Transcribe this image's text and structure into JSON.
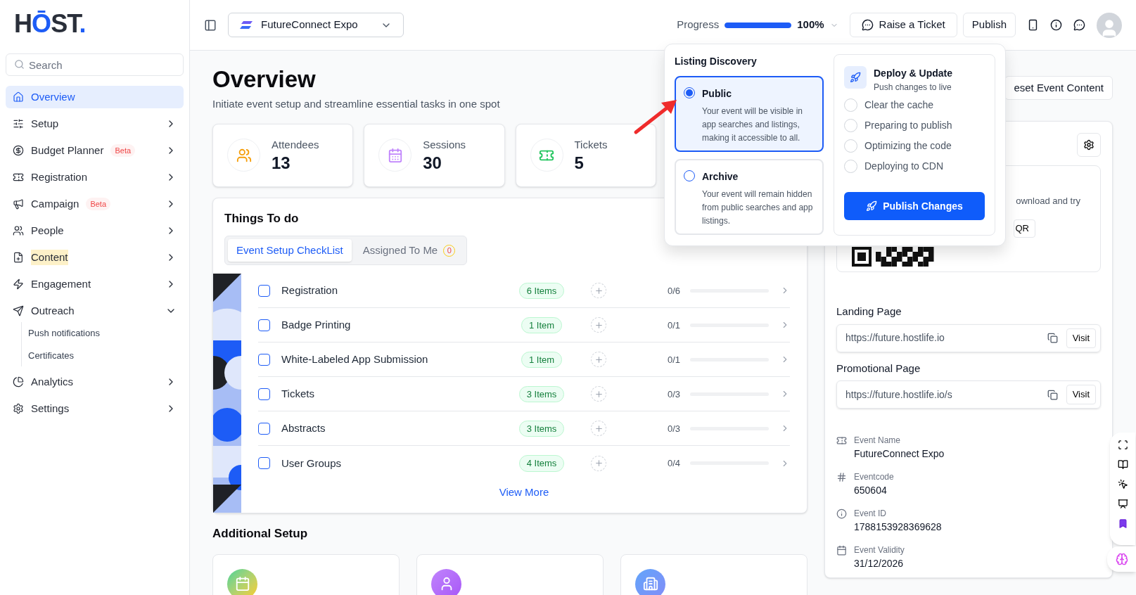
{
  "logo": {
    "parts": [
      {
        "text": "H",
        "accent": false
      },
      {
        "text": "Ō",
        "accent": true
      },
      {
        "text": "ST",
        "accent": false
      },
      {
        "text": ".",
        "accent": true
      }
    ]
  },
  "sidebar": {
    "search_placeholder": "Search",
    "items": [
      {
        "label": "Overview",
        "selected": true
      },
      {
        "label": "Setup",
        "selected": false,
        "expanded": false
      },
      {
        "label": "Budget Planner",
        "badge": "Beta",
        "selected": false,
        "expanded": false
      },
      {
        "label": "Registration",
        "selected": false,
        "expanded": false
      },
      {
        "label": "Campaign",
        "badge": "Beta",
        "selected": false,
        "expanded": false
      },
      {
        "label": "People",
        "selected": false,
        "expanded": false
      },
      {
        "label": "Content",
        "selected": false,
        "highlighted": true,
        "expanded": false
      },
      {
        "label": "Engagement",
        "selected": false,
        "expanded": false
      },
      {
        "label": "Outreach",
        "selected": false,
        "expanded": true,
        "children": [
          {
            "label": "Push notifications"
          },
          {
            "label": "Certificates"
          }
        ]
      },
      {
        "label": "Analytics",
        "selected": false,
        "expanded": false
      },
      {
        "label": "Settings",
        "selected": false,
        "expanded": false
      }
    ]
  },
  "topbar": {
    "event": "FutureConnect Expo",
    "progress": {
      "label": "Progress",
      "level": 1,
      "reading": "100%"
    },
    "buttons": [
      "Raise a Ticket",
      "Publish"
    ]
  },
  "page": {
    "title": "Overview",
    "subtitle": "Initiate event setup and streamline essential tasks in one spot",
    "stats": [
      {
        "label": "Attendees",
        "value": "13"
      },
      {
        "label": "Sessions",
        "value": "30"
      },
      {
        "label": "Tickets",
        "value": "5"
      }
    ],
    "todo": {
      "title": "Things To do",
      "tabs": [
        {
          "label": "Event Setup CheckList",
          "selected": true
        },
        {
          "label": "Assigned To Me",
          "count": "0",
          "selected": false
        }
      ],
      "rows": [
        {
          "name": "Registration",
          "checked": false,
          "badge": "6 Items",
          "count": "0/6",
          "level": 0
        },
        {
          "name": "Badge Printing",
          "checked": false,
          "badge": "1 Item",
          "count": "0/1",
          "level": 0
        },
        {
          "name": "White-Labeled App Submission",
          "checked": false,
          "badge": "1 Item",
          "count": "0/1",
          "level": 0
        },
        {
          "name": "Tickets",
          "checked": false,
          "badge": "3 Items",
          "count": "0/3",
          "level": 0
        },
        {
          "name": "Abstracts",
          "checked": false,
          "badge": "3 Items",
          "count": "0/3",
          "level": 0
        },
        {
          "name": "User Groups",
          "checked": false,
          "badge": "4 Items",
          "count": "0/4",
          "level": 0
        }
      ],
      "view_more": "View More"
    },
    "additional_setup": {
      "title": "Additional Setup"
    }
  },
  "right_panel": {
    "reset_button": "eset Event Content",
    "preview_text": "ownload and try",
    "qr_button": "QR",
    "links": [
      {
        "label": "Landing Page",
        "url": "https://future.hostlife.io",
        "button": "Visit"
      },
      {
        "label": "Promotional Page",
        "url": "https://future.hostlife.io/s",
        "button": "Visit"
      }
    ],
    "details": [
      {
        "label": "Event Name",
        "value": "FutureConnect Expo"
      },
      {
        "label": "Eventcode",
        "value": "650604"
      },
      {
        "label": "Event ID",
        "value": "1788153928369628"
      },
      {
        "label": "Event Validity",
        "value": "31/12/2026"
      }
    ]
  },
  "popup": {
    "listing": {
      "title": "Listing Discovery",
      "options": [
        {
          "title": "Public",
          "description": "Your event will be visible in app searches and listings, making it accessible to all.",
          "selected": true
        },
        {
          "title": "Archive",
          "description": "Your event will remain hidden from public searches and app listings.",
          "selected": false
        }
      ]
    },
    "deploy": {
      "title": "Deploy & Update",
      "subtitle": "Push changes to live",
      "steps": [
        {
          "label": "Clear the cache",
          "checked": false
        },
        {
          "label": "Preparing to publish",
          "checked": false
        },
        {
          "label": "Optimizing the code",
          "checked": false
        },
        {
          "label": "Deploying to CDN",
          "checked": false
        }
      ],
      "button": "Publish Changes"
    }
  }
}
